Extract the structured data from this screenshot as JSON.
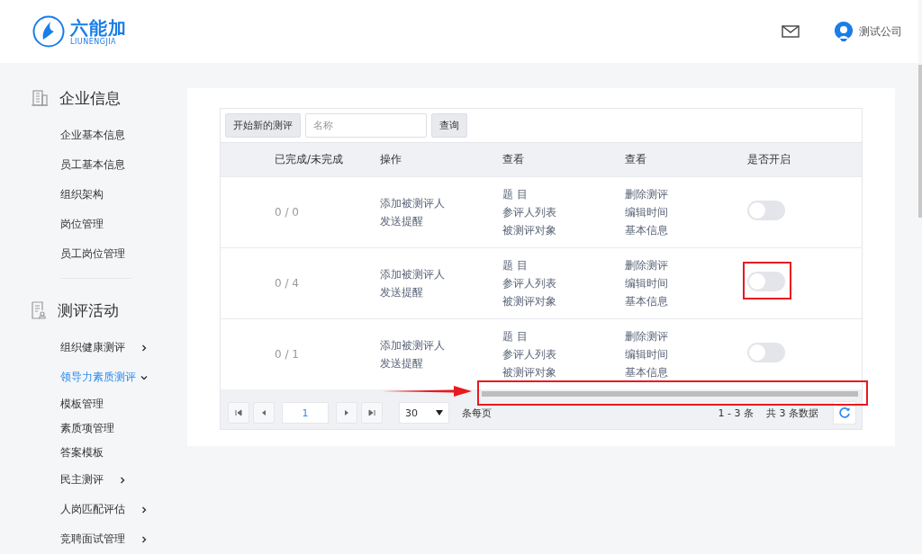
{
  "header": {
    "logo_text": "六能加",
    "logo_subtext": "LIUNENGJIA",
    "user_name": "测试公司"
  },
  "sidebar": {
    "sections": [
      {
        "title": "企业信息",
        "kind": "building",
        "items": [
          {
            "label": "企业基本信息",
            "selected": false
          },
          {
            "label": "员工基本信息",
            "selected": false
          },
          {
            "label": "组织架构",
            "selected": false
          },
          {
            "label": "岗位管理",
            "selected": false
          },
          {
            "label": "员工岗位管理",
            "selected": false
          }
        ]
      },
      {
        "title": "测评活动",
        "kind": "report",
        "items": [
          {
            "label": "组织健康测评",
            "selected": false,
            "expanded": false
          },
          {
            "label": "领导力素质测评",
            "selected": true,
            "expanded": true,
            "children": [
              {
                "label": "模板管理"
              },
              {
                "label": "素质项管理"
              },
              {
                "label": "答案模板"
              }
            ]
          },
          {
            "label": "民主测评",
            "selected": false,
            "expanded": false
          },
          {
            "label": "人岗匹配评估",
            "selected": false,
            "expanded": false
          },
          {
            "label": "竞聘面试管理",
            "selected": false,
            "expanded": false
          }
        ]
      }
    ]
  },
  "toolbar": {
    "new_button": "开始新的测评",
    "search": {
      "placeholder": "名称"
    },
    "query_button": "查询"
  },
  "table": {
    "columns": [
      "已完成/未完成",
      "操作",
      "查看",
      "查看",
      "是否开启"
    ],
    "rows": [
      {
        "progress": "0 / 0",
        "actions": [
          "添加被测评人",
          "发送提醒"
        ],
        "view": [
          "题 目",
          "参评人列表",
          "被测评对象"
        ],
        "view2": [
          "删除测评",
          "编辑时间",
          "基本信息"
        ],
        "on": false,
        "highlighted": false
      },
      {
        "progress": "0 / 4",
        "actions": [
          "添加被测评人",
          "发送提醒"
        ],
        "view": [
          "题 目",
          "参评人列表",
          "被测评对象"
        ],
        "view2": [
          "删除测评",
          "编辑时间",
          "基本信息"
        ],
        "on": false,
        "highlighted": true
      },
      {
        "progress": "0 / 1",
        "actions": [
          "添加被测评人",
          "发送提醒"
        ],
        "view": [
          "题 目",
          "参评人列表",
          "被测评对象"
        ],
        "view2": [
          "删除测评",
          "编辑时间",
          "基本信息"
        ],
        "on": false,
        "highlighted": false
      }
    ]
  },
  "pager": {
    "page": "1",
    "page_size": "30",
    "page_size_label": "条每页",
    "range": "1 - 3 条",
    "total": "共 3 条数据"
  }
}
